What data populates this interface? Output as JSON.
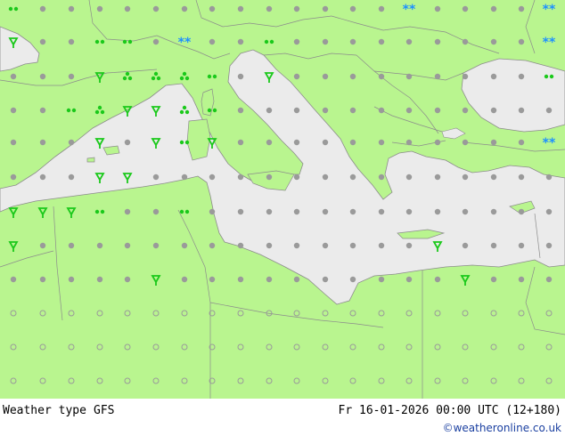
{
  "footer": {
    "title": "Weather type",
    "model": "GFS",
    "datetime": "Fr 16-01-2026 00:00 UTC (12+180)",
    "credit": "©weatheronline.co.uk"
  },
  "colors": {
    "land": "#b9f58f",
    "sea": "#ebebeb",
    "border": "#8c8c8c",
    "dot": "#9a9a9a",
    "rain": "#1bc91b",
    "snow": "#1e90ff"
  }
}
